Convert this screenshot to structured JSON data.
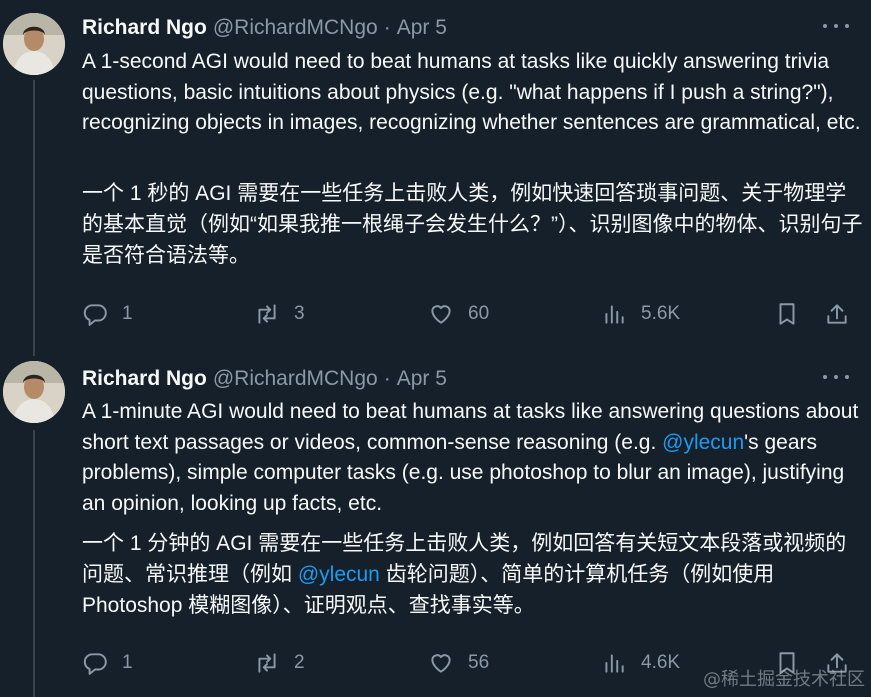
{
  "tweets": [
    {
      "name": "Richard Ngo",
      "handle": "@RichardMCNgo",
      "sep": "·",
      "date": "Apr 5",
      "text_en": "A 1-second AGI would need to beat humans at tasks like quickly answering trivia questions, basic intuitions about physics (e.g. \"what happens if I push a string?\"), recognizing objects in images, recognizing whether sentences are grammatical, etc.",
      "text_zh": "一个 1 秒的 AGI 需要在一些任务上击败人类，例如快速回答琐事问题、关于物理学的基本直觉（例如“如果我推一根绳子会发生什么？”）、识别图像中的物体、识别句子是否符合语法等。",
      "replies": "1",
      "retweets": "3",
      "likes": "60",
      "views": "5.6K"
    },
    {
      "name": "Richard Ngo",
      "handle": "@RichardMCNgo",
      "sep": "·",
      "date": "Apr 5",
      "text_en_1": "A 1-minute AGI would need to beat humans at tasks like answering questions about short text passages or videos, common-sense reasoning (e.g. ",
      "mention_en": "@ylecun",
      "text_en_2": "'s gears problems), simple computer tasks (e.g. use photoshop to blur an image), justifying an opinion, looking up facts, etc.",
      "text_zh_1": "一个 1 分钟的 AGI 需要在一些任务上击败人类，例如回答有关短文本段落或视频的问题、常识推理（例如 ",
      "mention_zh": "@ylecun",
      "text_zh_2": " 齿轮问题）、简单的计算机任务（例如使用 Photoshop 模糊图像）、证明观点、查找事实等。",
      "replies": "1",
      "retweets": "2",
      "likes": "56",
      "views": "4.6K"
    }
  ],
  "icons": [
    "avatar",
    "more-icon",
    "reply-icon",
    "retweet-icon",
    "like-icon",
    "views-icon",
    "bookmark-icon",
    "share-icon"
  ],
  "colors": {
    "background": "#15202b",
    "text": "#f7f9f9",
    "muted": "#8b98a5",
    "link": "#1d9bf0"
  },
  "watermark": "@稀土掘金技术社区"
}
